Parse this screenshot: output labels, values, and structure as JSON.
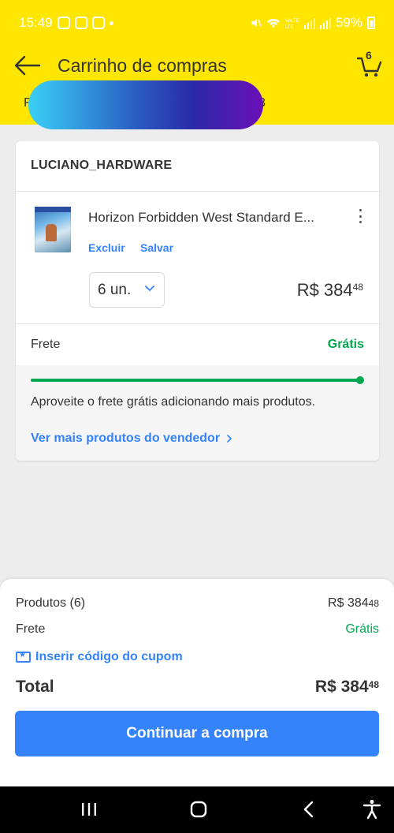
{
  "status_bar": {
    "time": "15:49",
    "icons_left": [
      "instagram-icon",
      "instagram-icon",
      "app-e-icon",
      "dot-icon"
    ],
    "icons_right": [
      "mute-icon",
      "wifi-icon",
      "volte-icon",
      "signal-icon",
      "signal-icon"
    ],
    "battery": "59%"
  },
  "header": {
    "title": "Carrinho de compras",
    "cart_count": "6",
    "tab_fragment_left": "F",
    "tab_fragment_right": "3"
  },
  "seller": {
    "name": "LUCIANO_HARDWARE"
  },
  "item": {
    "name": "Horizon Forbidden West Standard E...",
    "remove_label": "Excluir",
    "save_label": "Salvar",
    "quantity": "6 un.",
    "price_main": "R$ 384",
    "price_cents": "48"
  },
  "shipping": {
    "label": "Frete",
    "value": "Grátis",
    "progress": 1.0,
    "message": "Aproveite o frete grátis adicionando mais produtos.",
    "link": "Ver mais produtos do vendedor"
  },
  "summary": {
    "products_label": "Produtos (6)",
    "products_main": "R$ 384",
    "products_cents": "48",
    "shipping_label": "Frete",
    "shipping_value": "Grátis",
    "coupon_label": "Inserir código do cupom",
    "total_label": "Total",
    "total_main": "R$ 384",
    "total_cents": "48",
    "cta_label": "Continuar a compra"
  },
  "colors": {
    "brand_yellow": "#ffe600",
    "accent_blue": "#3483fa",
    "success_green": "#00a650"
  }
}
